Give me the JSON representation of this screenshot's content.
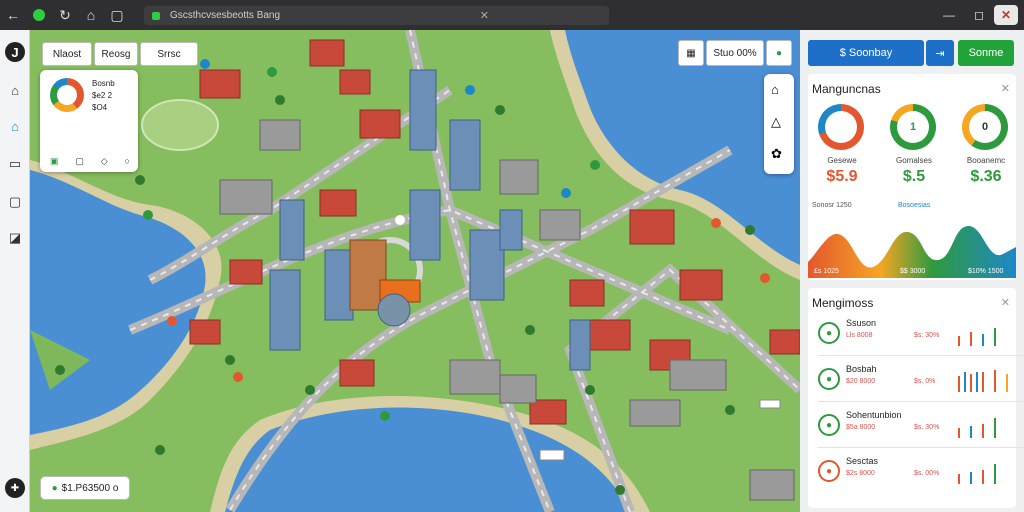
{
  "browser": {
    "url": "Gscsthcvsesbeotts Bang",
    "close_label": "✕",
    "window": {
      "minimize": "—",
      "maximize": "◻",
      "close": "✕"
    }
  },
  "toolbar": {
    "chips": [
      "Nlaost",
      "Reosg",
      "Srrsc"
    ],
    "status_label": "Stuo 00%"
  },
  "info_card": {
    "lines": [
      "Bosnb",
      "$e2 2",
      "$O4"
    ]
  },
  "right_panel": {
    "search_label": "$ Soonbay",
    "share_icon": "share-icon",
    "action_label": "Sonme",
    "section1_title": "Manguncnas",
    "gauges": [
      {
        "label": "Gesewe",
        "value": "$5.9",
        "inner": "",
        "color": "#e4572e"
      },
      {
        "label": "Gomalses",
        "value": "$.5",
        "inner": "1",
        "color": "#2e9a3e"
      },
      {
        "label": "Booanemc",
        "value": "$.36",
        "inner": "0",
        "color": "#2e9a3e"
      }
    ],
    "chart_labels_top": [
      "Sonosr 1250",
      "Bosoesias"
    ],
    "chart_labels_bottom": [
      "£s 1025",
      "$$ 3000",
      "$10% 1500"
    ],
    "section2_title": "Mengimoss",
    "metrics": [
      {
        "title": "Ssuson",
        "sub": "Lls 8008",
        "val": "$s: 30%"
      },
      {
        "title": "Bosbah",
        "sub": "$20 8000",
        "val": "$s. 0%"
      },
      {
        "title": "Sohentunbion",
        "sub": "$5a 8000",
        "val": "$s. 30%"
      },
      {
        "title": "Sesctas",
        "sub": "$2s 8000",
        "val": "$s. 00%"
      }
    ]
  },
  "footer": {
    "coords_label": "$1.P63500 o"
  },
  "colors": {
    "accent_blue": "#1e6fc7",
    "accent_green": "#22a33a",
    "water": "#4a8fd4",
    "grass": "#7fb85a"
  }
}
